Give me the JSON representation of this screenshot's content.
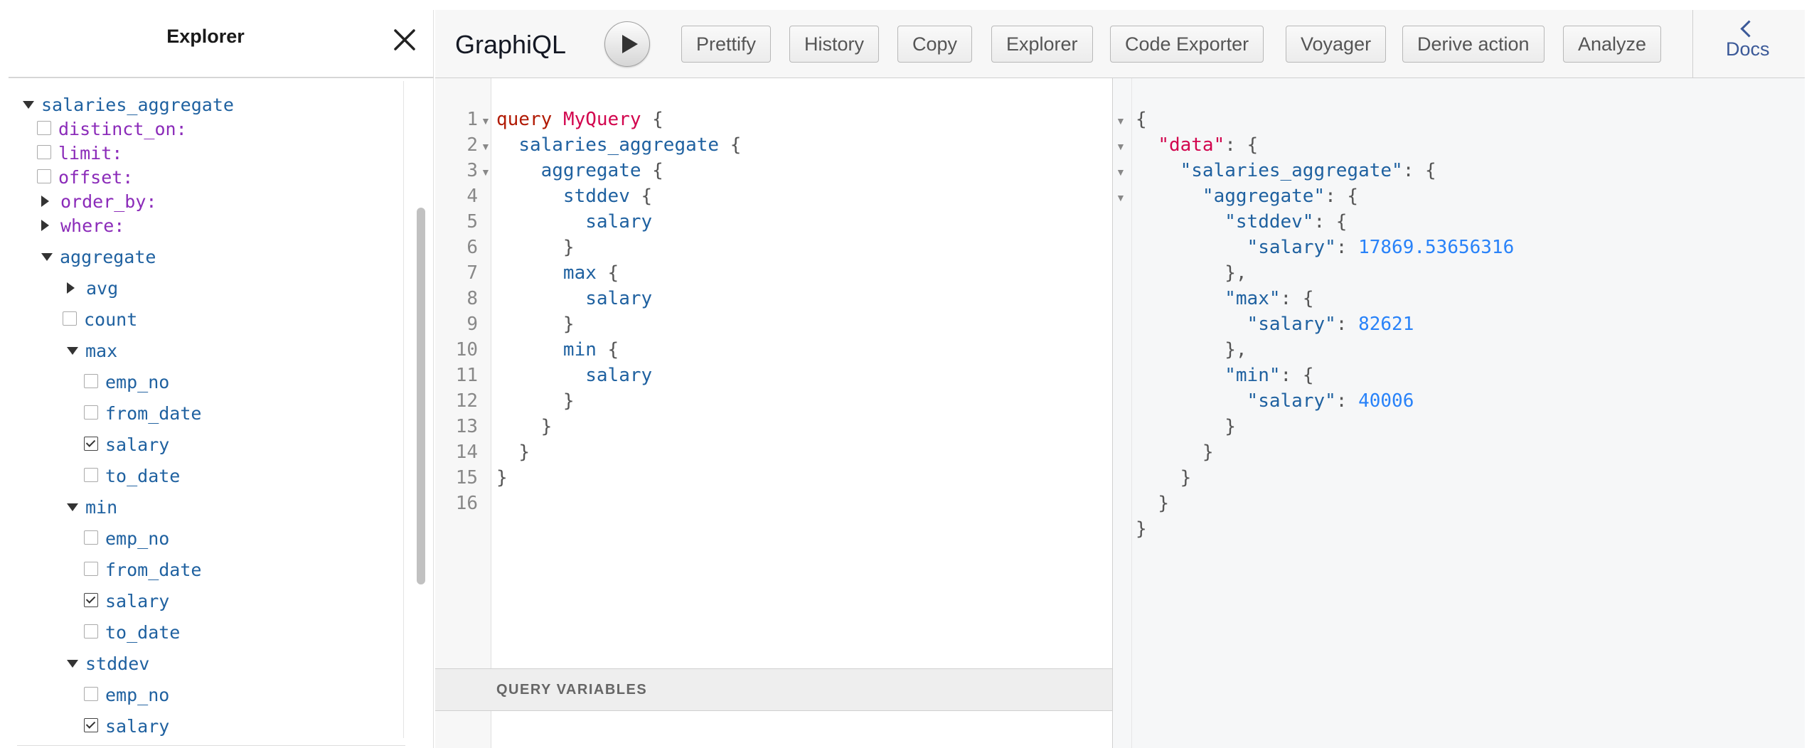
{
  "explorer": {
    "title": "Explorer",
    "tree": [
      {
        "label": "salaries_aggregate",
        "kind": "root"
      },
      {
        "label": "distinct_on:",
        "kind": "arg"
      },
      {
        "label": "limit:",
        "kind": "arg"
      },
      {
        "label": "offset:",
        "kind": "arg"
      },
      {
        "label": "order_by:",
        "kind": "arg-expand"
      },
      {
        "label": "where:",
        "kind": "arg-expand"
      },
      {
        "label": "aggregate",
        "kind": "field-open"
      },
      {
        "label": "avg",
        "kind": "field-closed"
      },
      {
        "label": "count",
        "kind": "leaf",
        "checked": false
      },
      {
        "label": "max",
        "kind": "field-open"
      },
      {
        "label": "emp_no",
        "kind": "leaf",
        "checked": false
      },
      {
        "label": "from_date",
        "kind": "leaf",
        "checked": false
      },
      {
        "label": "salary",
        "kind": "leaf",
        "checked": true
      },
      {
        "label": "to_date",
        "kind": "leaf",
        "checked": false
      },
      {
        "label": "min",
        "kind": "field-open"
      },
      {
        "label": "emp_no",
        "kind": "leaf",
        "checked": false
      },
      {
        "label": "from_date",
        "kind": "leaf",
        "checked": false
      },
      {
        "label": "salary",
        "kind": "leaf",
        "checked": true
      },
      {
        "label": "to_date",
        "kind": "leaf",
        "checked": false
      },
      {
        "label": "stddev",
        "kind": "field-open"
      },
      {
        "label": "emp_no",
        "kind": "leaf",
        "checked": false
      },
      {
        "label": "salary",
        "kind": "leaf",
        "checked": true
      }
    ]
  },
  "toolbar": {
    "title": "GraphiQL",
    "buttons": [
      "Prettify",
      "History",
      "Copy",
      "Explorer",
      "Code Exporter",
      "Voyager",
      "Derive action",
      "Analyze"
    ],
    "docs_label": "Docs"
  },
  "query_editor": {
    "lines": [
      "query MyQuery {",
      "  salaries_aggregate {",
      "    aggregate {",
      "      stddev {",
      "        salary",
      "      }",
      "      max {",
      "        salary",
      "      }",
      "      min {",
      "        salary",
      "      }",
      "    }",
      "  }",
      "}",
      ""
    ],
    "line_numbers": [
      "1",
      "2",
      "3",
      "4",
      "5",
      "6",
      "7",
      "8",
      "9",
      "10",
      "11",
      "12",
      "13",
      "14",
      "15",
      "16"
    ]
  },
  "variables": {
    "header": "QUERY VARIABLES"
  },
  "result": {
    "lines": [
      "{",
      "  \"data\": {",
      "    \"salaries_aggregate\": {",
      "      \"aggregate\": {",
      "        \"stddev\": {",
      "          \"salary\": 17869.53656316",
      "        },",
      "        \"max\": {",
      "          \"salary\": 82621",
      "        },",
      "        \"min\": {",
      "          \"salary\": 40006",
      "        }",
      "      }",
      "    }",
      "  }",
      "}"
    ],
    "values": {
      "stddev_salary": "17869.53656316",
      "max_salary": "82621",
      "min_salary": "40006"
    }
  }
}
